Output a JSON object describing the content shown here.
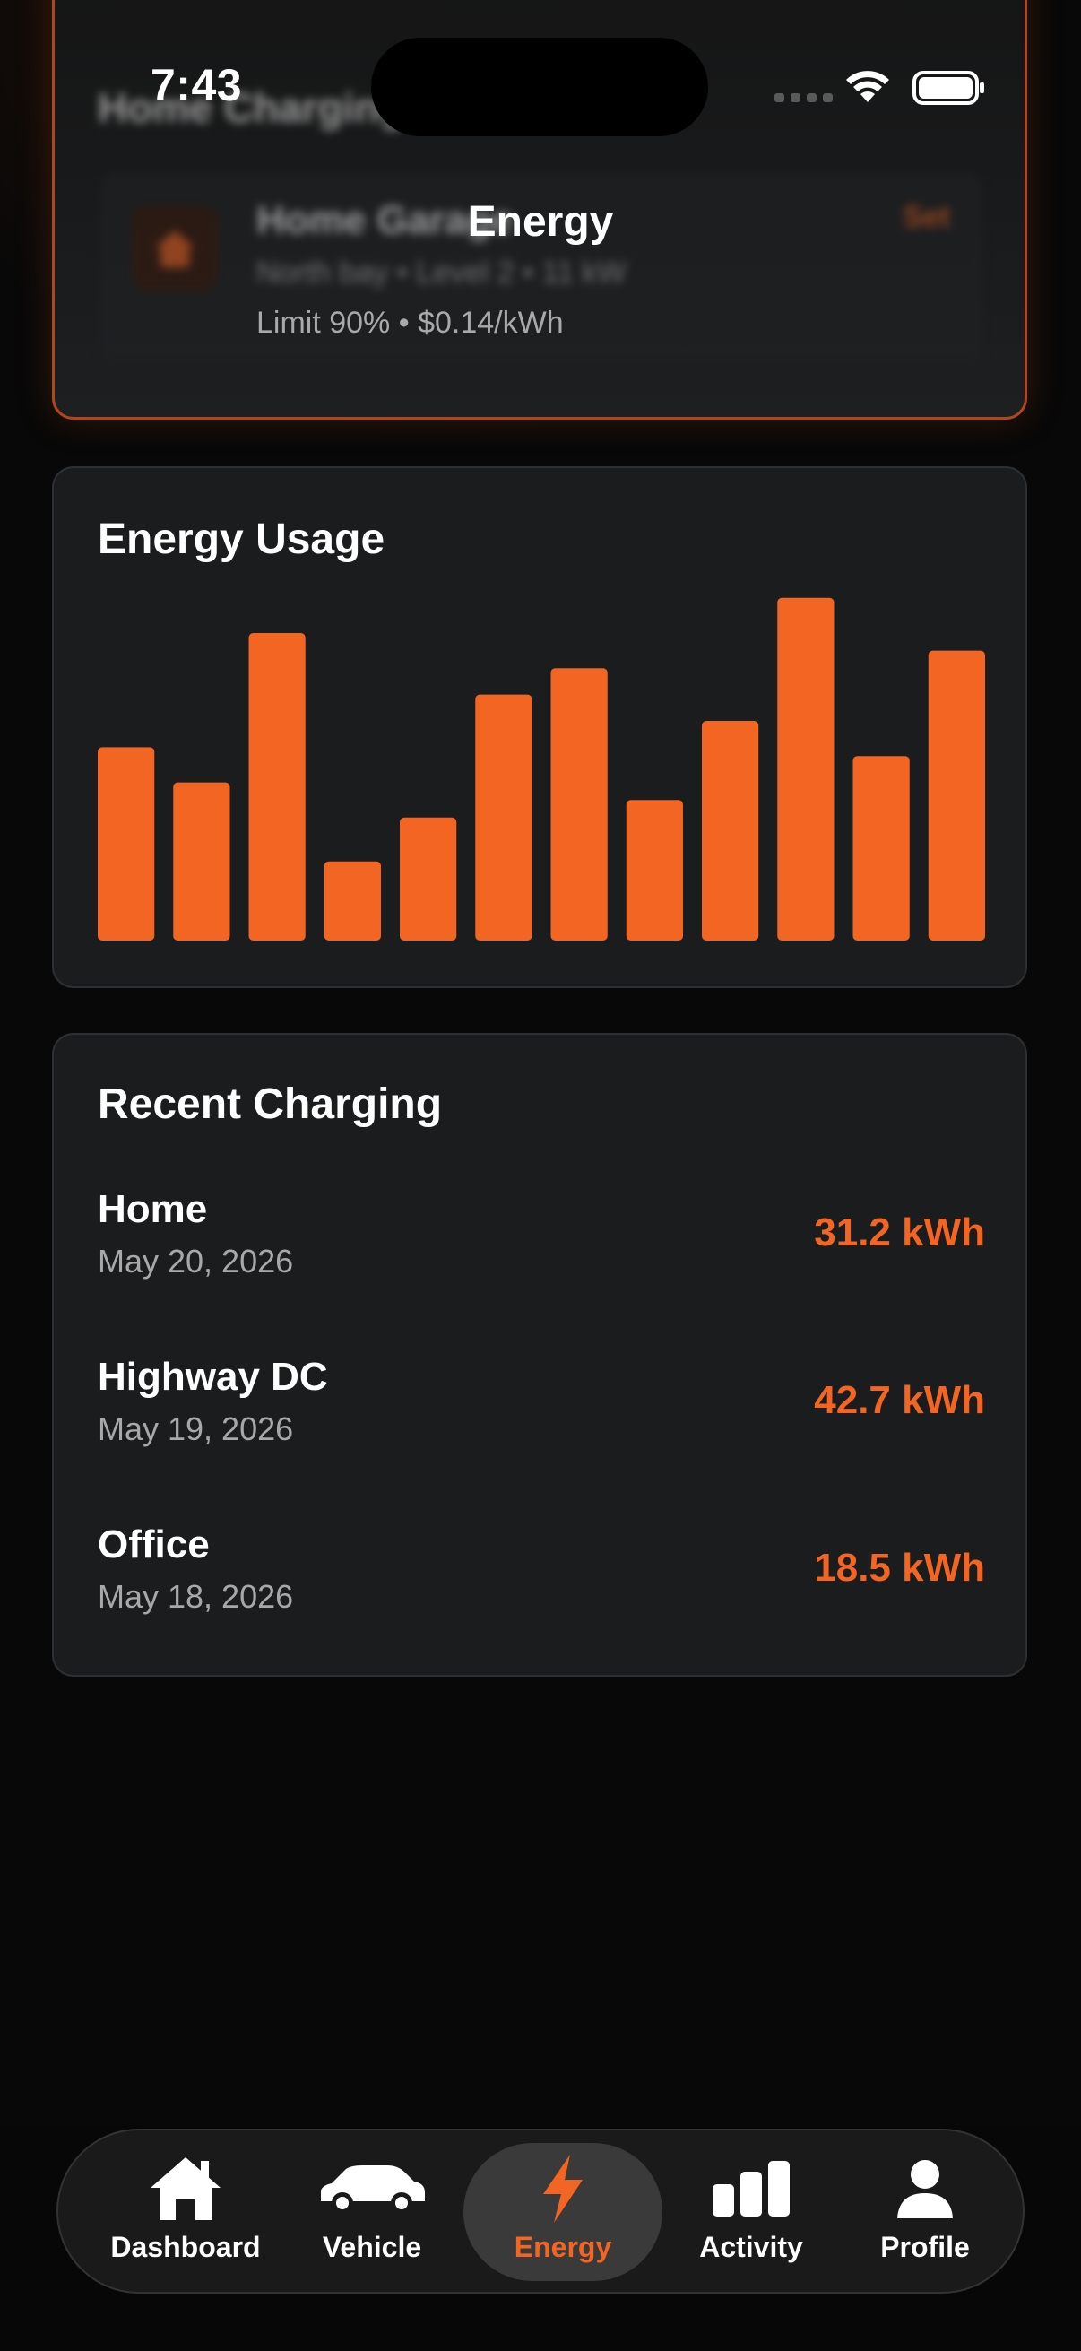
{
  "status_bar": {
    "time": "7:43"
  },
  "header": {
    "title": "Energy"
  },
  "charger_card": {
    "title": "Home Charging",
    "charger_name": "Home Garage",
    "spec": "North bay • Level 2 • 11 kW",
    "action_label": "Set",
    "limit_text": "Limit 90% • $0.14/kWh"
  },
  "usage_card": {
    "title": "Energy Usage"
  },
  "chart_data": {
    "type": "bar",
    "values": [
      22,
      18,
      35,
      9,
      14,
      28,
      31,
      16,
      25,
      39,
      21,
      33
    ],
    "ylim": [
      0,
      40
    ],
    "color": "#f26522"
  },
  "recent_card": {
    "title": "Recent Charging",
    "sessions": [
      {
        "name": "Home",
        "date": "May 20, 2026",
        "energy": "31.2 kWh"
      },
      {
        "name": "Highway DC",
        "date": "May 19, 2026",
        "energy": "42.7 kWh"
      },
      {
        "name": "Office",
        "date": "May 18, 2026",
        "energy": "18.5 kWh"
      }
    ]
  },
  "tab_bar": {
    "active": "Energy",
    "accent_color": "#f26522",
    "tabs": [
      {
        "label": "Dashboard",
        "icon": "house-icon"
      },
      {
        "label": "Vehicle",
        "icon": "car-icon"
      },
      {
        "label": "Energy",
        "icon": "bolt-icon"
      },
      {
        "label": "Activity",
        "icon": "bar-chart-icon"
      },
      {
        "label": "Profile",
        "icon": "person-icon"
      }
    ]
  }
}
